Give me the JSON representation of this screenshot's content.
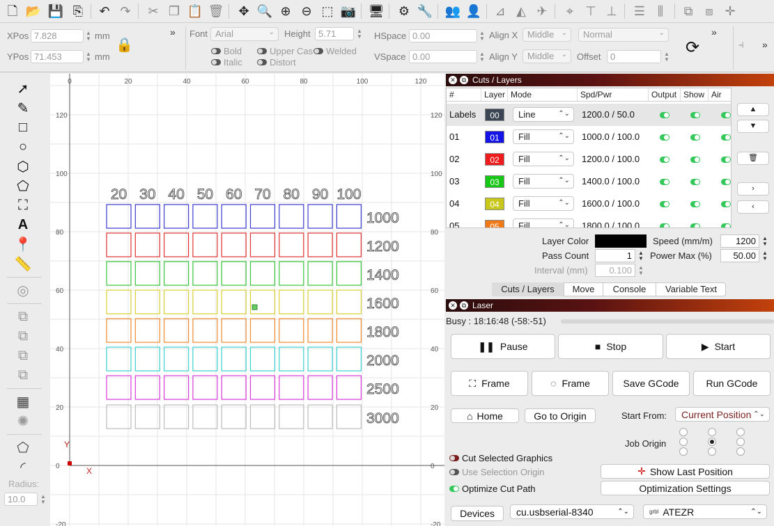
{
  "props": {
    "xpos_label": "XPos",
    "xpos_value": "7.828",
    "ypos_label": "YPos",
    "ypos_value": "71.453",
    "unit": "mm",
    "font_label": "Font",
    "font_value": "Arial",
    "height_label": "Height",
    "height_value": "5.71",
    "hspace_label": "HSpace",
    "hspace_value": "0.00",
    "vspace_label": "VSpace",
    "vspace_value": "0.00",
    "alignx_label": "Align X",
    "alignx_value": "Middle",
    "aligny_label": "Align Y",
    "aligny_value": "Middle",
    "style_value": "Normal",
    "offset_label": "Offset",
    "offset_value": "0",
    "bold": "Bold",
    "italic": "Italic",
    "upper": "Upper Cas",
    "distort": "Distort",
    "welded": "Welded"
  },
  "tools": {
    "radius_label": "Radius:",
    "radius_value": "10.0"
  },
  "canvas": {
    "xticks": [
      "0",
      "20",
      "40",
      "60",
      "80",
      "100",
      "120"
    ],
    "yticks": [
      "120",
      "100",
      "80",
      "60",
      "40",
      "20",
      "0",
      "-20"
    ],
    "axis_x": "X",
    "axis_y": "Y",
    "col_labels": [
      "20",
      "30",
      "40",
      "50",
      "60",
      "70",
      "80",
      "90",
      "100"
    ],
    "row_labels": [
      "1000",
      "1200",
      "1400",
      "1600",
      "1800",
      "2000",
      "2500",
      "3000"
    ],
    "row_colors": [
      "#3b3bd0",
      "#e03030",
      "#38c438",
      "#d8d030",
      "#f08a30",
      "#38d0d0",
      "#d838d8",
      "#bbbbbb"
    ]
  },
  "layers": {
    "title": "Cuts / Layers",
    "headers": [
      "#",
      "Layer",
      "Mode",
      "Spd/Pwr",
      "Output",
      "Show",
      "Air"
    ],
    "rows": [
      {
        "id": "Labels",
        "layer": "00",
        "color": "#3a4452",
        "mode": "Line",
        "spd": "1200.0 / 50.0"
      },
      {
        "id": "01",
        "layer": "01",
        "color": "#1414e6",
        "mode": "Fill",
        "spd": "1000.0 / 100.0"
      },
      {
        "id": "02",
        "layer": "02",
        "color": "#ee1c1c",
        "mode": "Fill",
        "spd": "1200.0 / 100.0"
      },
      {
        "id": "03",
        "layer": "03",
        "color": "#16c716",
        "mode": "Fill",
        "spd": "1400.0 / 100.0"
      },
      {
        "id": "04",
        "layer": "04",
        "color": "#c8c81a",
        "mode": "Fill",
        "spd": "1600.0 / 100.0"
      },
      {
        "id": "05",
        "layer": "05",
        "color": "#f07a18",
        "mode": "Fill",
        "spd": "1800.0 / 100.0"
      }
    ],
    "layer_color_label": "Layer Color",
    "speed_label": "Speed (mm/m)",
    "speed_value": "1200",
    "pass_label": "Pass Count",
    "pass_value": "1",
    "power_label": "Power Max (%)",
    "power_value": "50.00",
    "interval_label": "Interval (mm)",
    "interval_value": "0.100",
    "tabs": [
      "Cuts / Layers",
      "Move",
      "Console",
      "Variable Text"
    ]
  },
  "laser": {
    "title": "Laser",
    "status": "Busy : 18:16:48 (-58:-51)",
    "pause": "Pause",
    "stop": "Stop",
    "start": "Start",
    "frame1": "Frame",
    "frame2": "Frame",
    "save_gcode": "Save GCode",
    "run_gcode": "Run GCode",
    "home": "Home",
    "go_origin": "Go to Origin",
    "start_from_label": "Start From:",
    "start_from_value": "Current Position",
    "job_origin_label": "Job Origin",
    "cut_selected": "Cut Selected Graphics",
    "use_selection": "Use Selection Origin",
    "optimize": "Optimize Cut Path",
    "show_last": "Show Last Position",
    "opt_settings": "Optimization Settings",
    "devices": "Devices",
    "port": "cu.usbserial-8340",
    "device": "ATEZR",
    "device_prefix": "grbl"
  }
}
